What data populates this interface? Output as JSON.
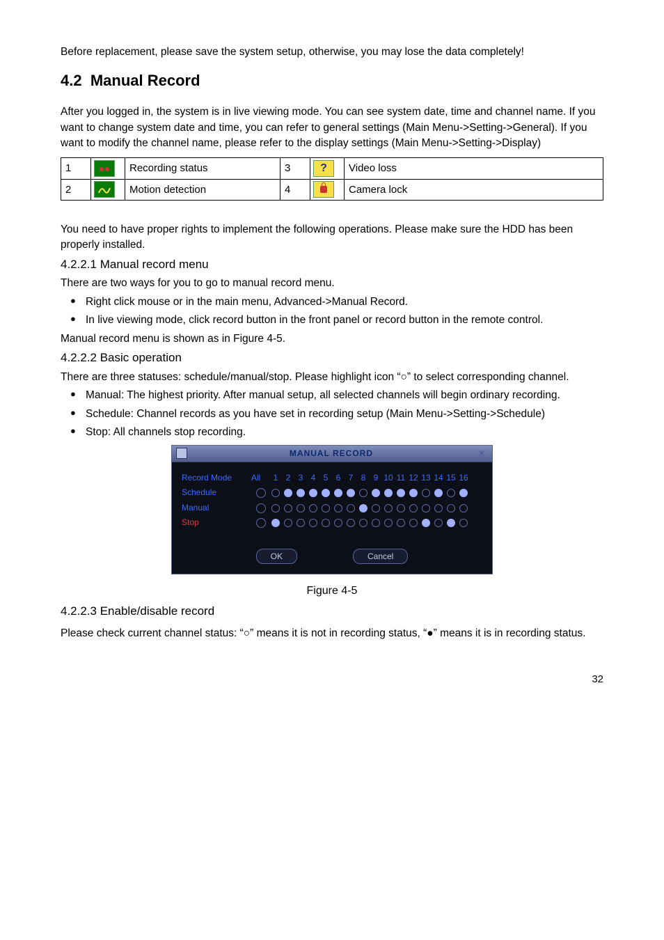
{
  "intro": {
    "p1": "Before replacement, please save the system setup, otherwise, you may lose the data completely!"
  },
  "section": {
    "number": "4.2",
    "title": "Manual Record",
    "p1": "After you logged in, the system is in live viewing mode. You can see system date, time and channel name. If you want to change system date and time, you can refer to general settings (Main Menu->Setting->General). If you want to modify the channel name, please refer to the display settings (Main Menu->Setting->Display)"
  },
  "status_table": {
    "rows": [
      {
        "n": "1",
        "icon": "recording-status-icon",
        "desc": "Recording status",
        "n2": "3",
        "icon2": "video-loss-icon",
        "desc2": "Video loss"
      },
      {
        "n": "2",
        "icon": "motion-detection-icon",
        "desc": "Motion detection",
        "n2": "4",
        "icon2": "camera-lock-icon",
        "desc2": "Camera lock"
      }
    ]
  },
  "rights": {
    "p1": "You need to have proper rights to implement the following operations. Please make sure the HDD has been properly installed."
  },
  "s4221": {
    "hdr": "4.2.2.1  Manual record menu",
    "p1": "There are two ways for you to go to manual record menu.",
    "b1": "Right click mouse or in the main menu, Advanced->Manual Record.",
    "b2": "In live viewing mode, click record button in the front panel or record button in the remote control.",
    "p2": "Manual record menu is shown as in Figure 4-5."
  },
  "s4222": {
    "hdr": "4.2.2.2  Basic operation",
    "p1": "There are three statuses: schedule/manual/stop. Please highlight icon “○”  to select corresponding channel.",
    "b1": "Manual: The highest priority. After manual setup, all selected channels will begin ordinary recording.",
    "b2": "Schedule: Channel records as you have set in recording setup (Main Menu->Setting->Schedule)",
    "b3": "Stop: All channels stop recording."
  },
  "dialog": {
    "title": "MANUAL RECORD",
    "row_labels": {
      "mode": "Record Mode",
      "all": "All",
      "sched": "Schedule",
      "manual": "Manual",
      "stop": "Stop"
    },
    "channels": [
      "1",
      "2",
      "3",
      "4",
      "5",
      "6",
      "7",
      "8",
      "9",
      "10",
      "11",
      "12",
      "13",
      "14",
      "15",
      "16"
    ],
    "schedule": [
      0,
      1,
      1,
      1,
      1,
      1,
      1,
      0,
      1,
      1,
      1,
      1,
      0,
      1,
      0,
      1
    ],
    "manual": [
      0,
      0,
      0,
      0,
      0,
      0,
      0,
      1,
      0,
      0,
      0,
      0,
      0,
      0,
      0,
      0
    ],
    "stop": [
      1,
      0,
      0,
      0,
      0,
      0,
      0,
      0,
      0,
      0,
      0,
      0,
      1,
      0,
      1,
      0
    ],
    "ok": "OK",
    "cancel": "Cancel"
  },
  "figure_caption": "Figure 4-5",
  "s4223": {
    "hdr": "4.2.2.3  Enable/disable record",
    "p1": "Please check current channel status: “○” means it is not in recording status, “●” means it is in recording status."
  },
  "page_number": "32"
}
